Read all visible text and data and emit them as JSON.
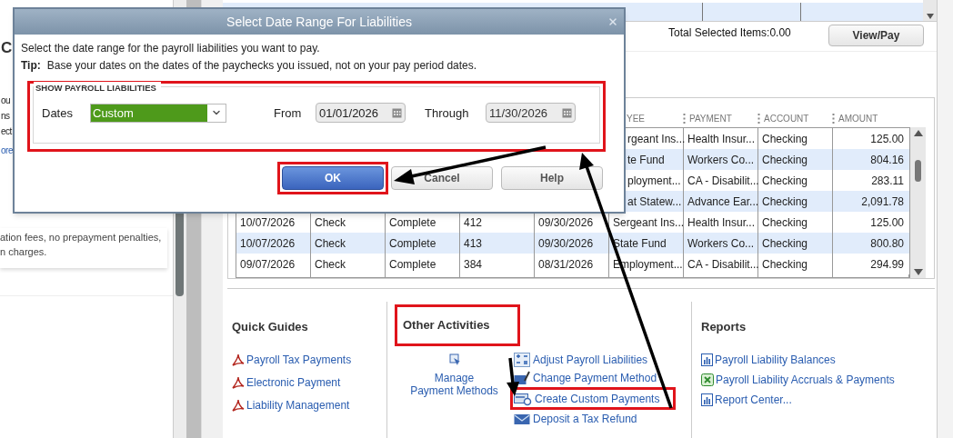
{
  "left_panel": {
    "heading": "C",
    "fragments": [
      "ou",
      "ns",
      "ect"
    ],
    "link": "ore",
    "note_lines": [
      "ation fees, no prepayment penalties,",
      "n charges."
    ]
  },
  "summary": {
    "total": "Total Selected Items:0.00",
    "button": "View/Pay"
  },
  "table": {
    "columns": [
      "YEE",
      "PAYMENT",
      "ACCOUNT",
      "AMOUNT"
    ],
    "rows": [
      {
        "payee": "rgeant Ins...",
        "payment": "Health Insur...",
        "account": "Checking",
        "amount": "125.00"
      },
      {
        "payee": "te Fund",
        "payment": "Workers Co...",
        "account": "Checking",
        "amount": "804.16"
      },
      {
        "payee": "ployment...",
        "payment": "CA - Disabilit...",
        "account": "Checking",
        "amount": "283.11"
      },
      {
        "payee": "at Statew...",
        "payment": "Advance Ear...",
        "account": "Checking",
        "amount": "2,091.78"
      },
      {
        "date": "10/07/2026",
        "type": "Check",
        "status": "Complete",
        "number": "412",
        "period": "09/30/2026",
        "payee": "Sergeant Ins...",
        "payment": "Health Insur...",
        "account": "Checking",
        "amount": "125.00"
      },
      {
        "date": "10/07/2026",
        "type": "Check",
        "status": "Complete",
        "number": "413",
        "period": "09/30/2026",
        "payee": "State Fund",
        "payment": "Workers Co...",
        "account": "Checking",
        "amount": "800.80"
      },
      {
        "date": "09/07/2026",
        "type": "Check",
        "status": "Complete",
        "number": "384",
        "period": "08/31/2026",
        "payee": "Employment...",
        "payment": "CA - Disabilit...",
        "account": "Checking",
        "amount": "294.99"
      }
    ]
  },
  "quick_guides": {
    "title": "Quick Guides",
    "items": [
      "Payroll Tax Payments",
      "Electronic Payment",
      "Liability Management"
    ]
  },
  "other_activities": {
    "title": "Other Activities",
    "manage": [
      "Manage",
      "Payment Methods"
    ],
    "items": [
      {
        "label": "Adjust Payroll Liabilities",
        "kind": "adjust",
        "highlighted": false
      },
      {
        "label": "Change Payment Method",
        "kind": "change",
        "highlighted": false
      },
      {
        "label": "Create Custom Payments",
        "kind": "create",
        "highlighted": true
      },
      {
        "label": "Deposit a Tax Refund",
        "kind": "deposit",
        "highlighted": false
      }
    ]
  },
  "reports": {
    "title": "Reports",
    "items": [
      {
        "label": "Payroll Liability Balances",
        "kind": "report"
      },
      {
        "label": "Payroll Liability Accruals & Payments",
        "kind": "excel"
      },
      {
        "label": "Report Center...",
        "kind": "report"
      }
    ]
  },
  "dialog": {
    "title": "Select Date Range For Liabilities",
    "instruction": "Select the date range for the payroll liabilities you want to pay.",
    "tip_label": "Tip:",
    "tip": "Base your dates on the dates of the paychecks you issued, not on your pay period dates.",
    "group_title": "SHOW PAYROLL LIABILITIES",
    "dates_label": "Dates",
    "dates_value": "Custom",
    "from_label": "From",
    "from_value": "01/01/2026",
    "through_label": "Through",
    "through_value": "11/30/2026",
    "buttons": [
      "OK",
      "Cancel",
      "Help"
    ]
  }
}
